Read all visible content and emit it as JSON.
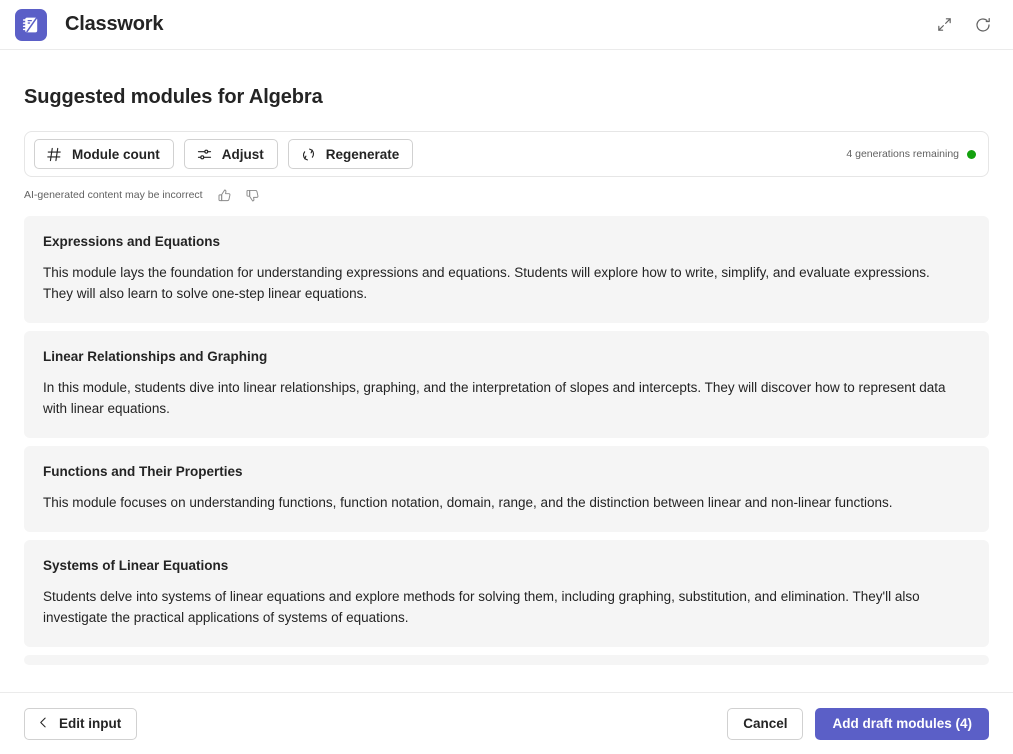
{
  "header": {
    "app_name": "Classwork",
    "app_icon": "classwork-notebook-icon",
    "actions": [
      {
        "name": "expand-icon",
        "label": "Expand"
      },
      {
        "name": "refresh-icon",
        "label": "Refresh"
      }
    ]
  },
  "page": {
    "title": "Suggested modules for Algebra"
  },
  "toolbar": {
    "buttons": [
      {
        "label": "Module count",
        "icon": "number-sign-icon"
      },
      {
        "label": "Adjust",
        "icon": "sliders-icon"
      },
      {
        "label": "Regenerate",
        "icon": "circular-arrows-icon"
      }
    ],
    "generations_remaining": "4 generations remaining",
    "status_color": "#13a10e"
  },
  "disclaimer": {
    "text": "AI-generated content may be incorrect",
    "thumbs_up": "thumb-like-icon",
    "thumbs_down": "thumb-dislike-icon"
  },
  "modules": [
    {
      "title": "Expressions and Equations",
      "description": "This module lays the foundation for understanding expressions and equations. Students will explore how to write, simplify, and evaluate expressions. They will also learn to solve one-step linear equations."
    },
    {
      "title": "Linear Relationships and Graphing",
      "description": "In this module, students dive into linear relationships, graphing, and the interpretation of slopes and intercepts. They will discover how to represent data with linear equations."
    },
    {
      "title": "Functions and Their Properties",
      "description": "This module focuses on understanding functions, function notation, domain, range, and the distinction between linear and non-linear functions."
    },
    {
      "title": "Systems of Linear Equations",
      "description": "Students delve into systems of linear equations and explore methods for solving them, including graphing, substitution, and elimination. They'll also investigate the practical applications of systems of equations."
    }
  ],
  "footer": {
    "edit_input_label": "Edit input",
    "cancel_label": "Cancel",
    "primary_label": "Add draft modules (4)",
    "primary_color": "#5b5fc7"
  }
}
